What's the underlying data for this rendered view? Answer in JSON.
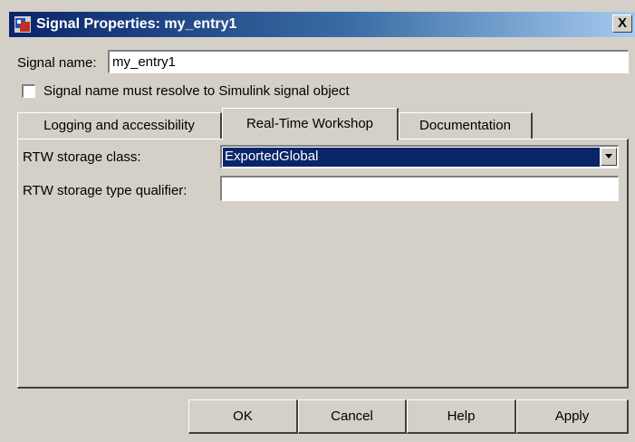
{
  "window": {
    "title": "Signal Properties: my_entry1",
    "close_label": "X"
  },
  "signal_name": {
    "label": "Signal name:",
    "value": "my_entry1"
  },
  "resolve_checkbox": {
    "label": "Signal name must resolve to Simulink signal object",
    "checked": false
  },
  "tabs": [
    {
      "label": "Logging and accessibility",
      "active": false
    },
    {
      "label": "Real-Time Workshop",
      "active": true
    },
    {
      "label": "Documentation",
      "active": false
    }
  ],
  "rtw": {
    "storage_class_label": "RTW storage class:",
    "storage_class_value": "ExportedGlobal",
    "type_qualifier_label": "RTW storage type qualifier:",
    "type_qualifier_value": ""
  },
  "buttons": {
    "ok": "OK",
    "cancel": "Cancel",
    "help": "Help",
    "apply": "Apply"
  },
  "colors": {
    "title_bar": "#0a246a",
    "dialog_bg": "#d4d0c8",
    "selection": "#0a246a"
  }
}
